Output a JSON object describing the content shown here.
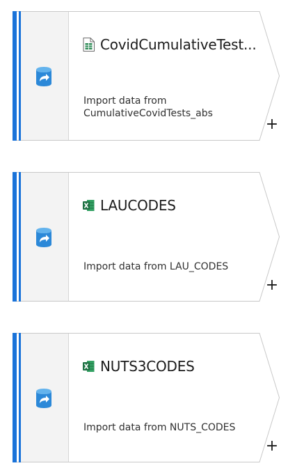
{
  "steps": [
    {
      "title": "CovidCumulativeTest...",
      "subtitle": "Import data from CumulativeCovidTests_abs",
      "file_icon": "csv-file-icon",
      "source_icon": "dataverse-import-icon",
      "add_label": "+"
    },
    {
      "title": "LAUCODES",
      "subtitle": "Import data from LAU_CODES",
      "file_icon": "excel-file-icon",
      "source_icon": "dataverse-import-icon",
      "add_label": "+"
    },
    {
      "title": "NUTS3CODES",
      "subtitle": "Import data from NUTS_CODES",
      "file_icon": "excel-file-icon",
      "source_icon": "dataverse-import-icon",
      "add_label": "+"
    }
  ],
  "colors": {
    "accent": "#1a73d9",
    "icon_blue": "#2b88d8",
    "excel_green": "#1f7244",
    "csv_green": "#2e8b57",
    "strip_bg": "#f3f3f3",
    "border": "#c8c8c8"
  }
}
